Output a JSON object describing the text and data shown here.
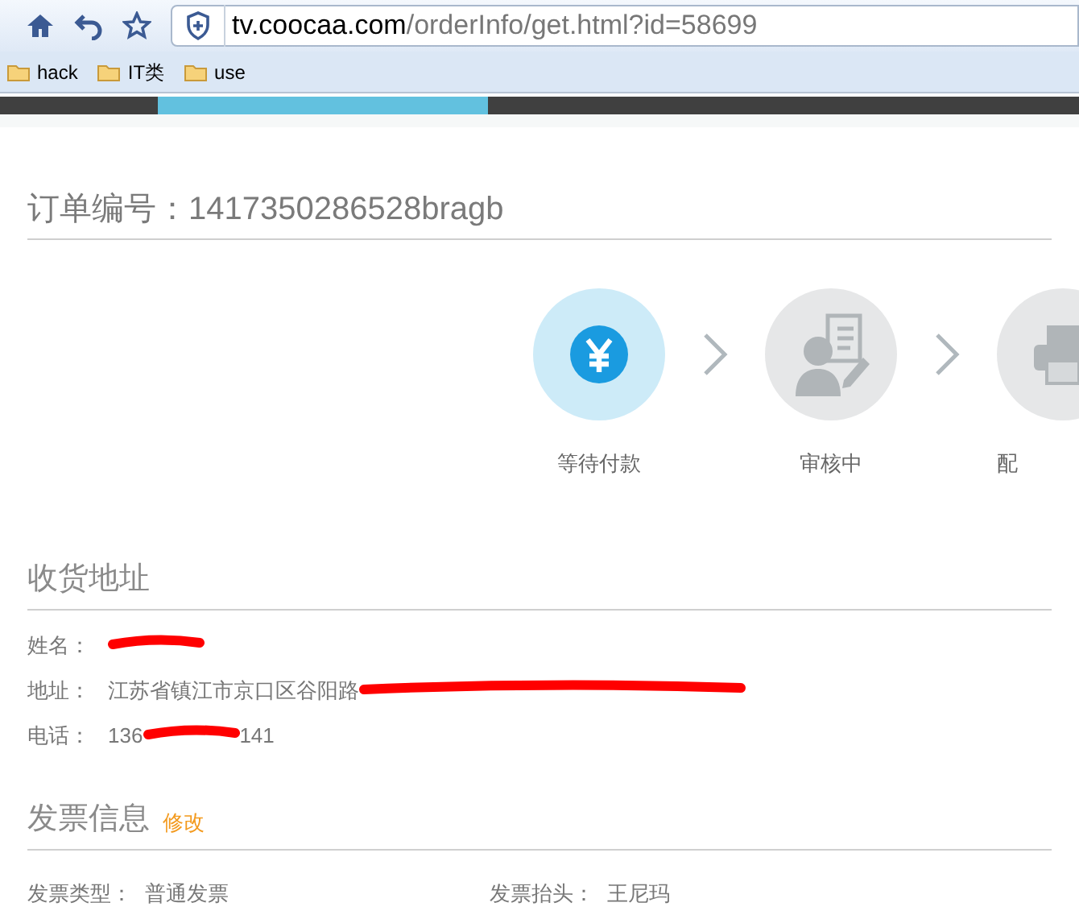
{
  "browser": {
    "url_host": "tv.coocaa.com",
    "url_path": "/orderInfo/get.html?id=58699",
    "bookmarks": [
      "hack",
      "IT类",
      "use"
    ]
  },
  "order": {
    "title": "订单编号：1417350286528bragb"
  },
  "steps": [
    {
      "kind": "payment",
      "label": "等待付款",
      "active": true
    },
    {
      "kind": "review",
      "label": "审核中",
      "active": false
    },
    {
      "kind": "print",
      "label": "配",
      "active": false
    }
  ],
  "address": {
    "heading": "收货地址",
    "rows": [
      {
        "label": "姓名：",
        "value": "",
        "redacted": true
      },
      {
        "label": "地址：",
        "value": "江苏省镇江市京口区谷阳路",
        "redacted": true
      },
      {
        "label": "电话：",
        "value": "136",
        "redacted": true,
        "tail": "141"
      }
    ]
  },
  "invoice": {
    "heading": "发票信息",
    "edit_link": "修改",
    "fields": [
      {
        "label": "发票类型：",
        "value": "普通发票"
      },
      {
        "label": "发票抬头：",
        "value": "王尼玛"
      }
    ]
  }
}
